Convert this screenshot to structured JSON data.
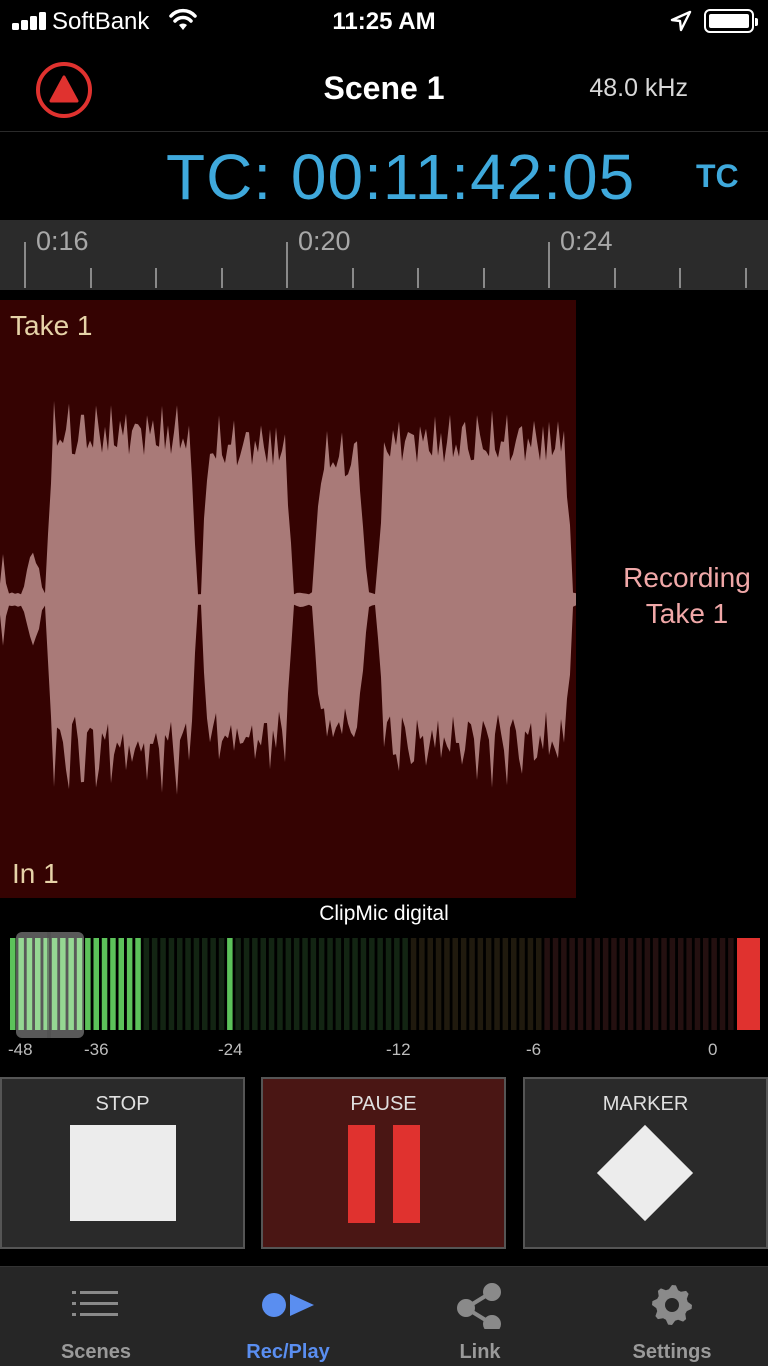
{
  "status_bar": {
    "carrier": "SoftBank",
    "time": "11:25 AM"
  },
  "header": {
    "title": "Scene 1",
    "sample_rate": "48.0 kHz"
  },
  "timecode": {
    "display": "TC: 00:11:42:05",
    "button": "TC"
  },
  "ruler": {
    "labels": [
      "0:16",
      "0:20",
      "0:24"
    ]
  },
  "take": {
    "name": "Take 1",
    "input": "In 1",
    "status_line1": "Recording",
    "status_line2": "Take 1"
  },
  "meter": {
    "device": "ClipMic digital",
    "scale": [
      "-48",
      "-36",
      "-24",
      "-12",
      "-6",
      "0"
    ],
    "clip_color": "#e0322f",
    "level_color": "#5cc25a"
  },
  "transport": {
    "stop": "STOP",
    "pause": "PAUSE",
    "marker": "MARKER"
  },
  "tabs": [
    {
      "label": "Scenes",
      "icon": "list-icon"
    },
    {
      "label": "Rec/Play",
      "icon": "rec-play-icon",
      "active": true
    },
    {
      "label": "Link",
      "icon": "share-icon"
    },
    {
      "label": "Settings",
      "icon": "gear-icon"
    }
  ]
}
